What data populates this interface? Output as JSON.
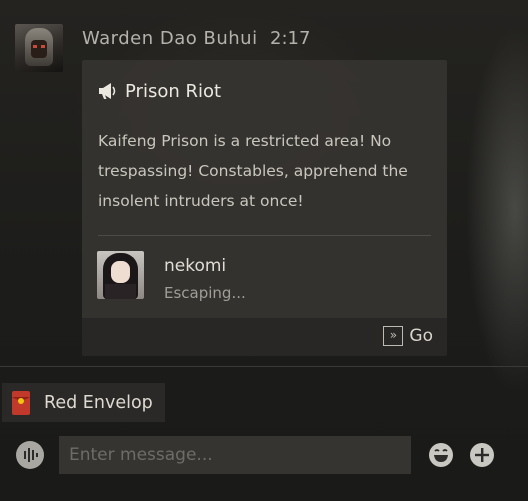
{
  "message": {
    "sender": "Warden Dao Buhui",
    "time": "2:17",
    "sender_avatar_icon": "armored-warden-avatar",
    "card": {
      "icon": "megaphone-icon",
      "title": "Prison Riot",
      "body": "Kaifeng Prison is a restricted area! No trespassing! Constables, apprehend the insolent intruders at once!",
      "user": {
        "name": "nekomi",
        "status": "Escaping..."
      },
      "action_label": "Go"
    }
  },
  "quick_actions": {
    "red_envelope_label": "Red Envelop"
  },
  "composer": {
    "placeholder": "Enter message..."
  },
  "colors": {
    "background": "#1a1a19",
    "card": "#363431",
    "accent_red": "#c0392b"
  }
}
